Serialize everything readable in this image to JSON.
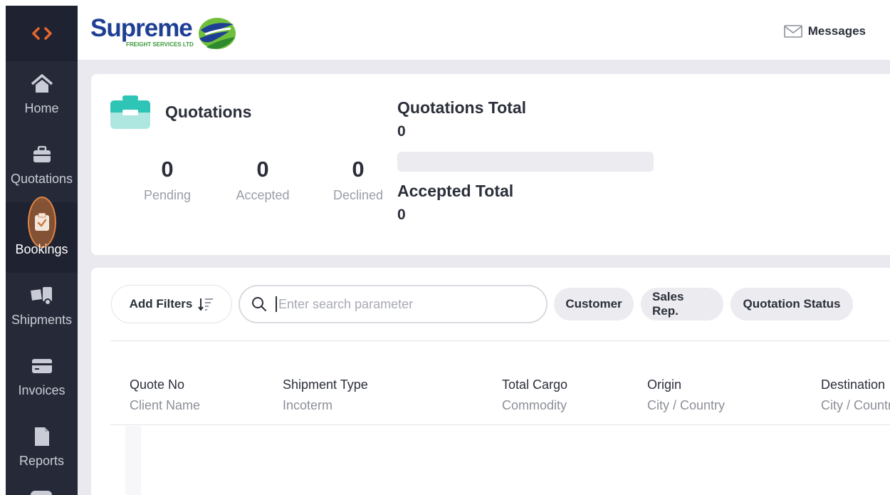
{
  "sidebar": {
    "logo_glyph": "<>",
    "items": [
      {
        "label": "Home",
        "icon": "home-icon"
      },
      {
        "label": "Quotations",
        "icon": "briefcase-icon"
      },
      {
        "label": "Bookings",
        "icon": "clipboard-check-icon",
        "active": true
      },
      {
        "label": "Shipments",
        "icon": "truck-icon"
      },
      {
        "label": "Invoices",
        "icon": "credit-card-icon"
      },
      {
        "label": "Reports",
        "icon": "document-icon"
      }
    ]
  },
  "header": {
    "brand_name": "Supreme",
    "brand_sub": "FREIGHT SERVICES LTD",
    "messages_label": "Messages"
  },
  "stats": {
    "title": "Quotations",
    "pending": {
      "value": "0",
      "label": "Pending"
    },
    "accepted": {
      "value": "0",
      "label": "Accepted"
    },
    "declined": {
      "value": "0",
      "label": "Declined"
    },
    "quotations_total_label": "Quotations Total",
    "quotations_total_value": "0",
    "accepted_total_label": "Accepted Total",
    "accepted_total_value": "0",
    "accepted_progress_fraction": 0
  },
  "filters": {
    "add_filters_label": "Add Filters",
    "search_placeholder": "Enter search parameter",
    "search_value": "",
    "chips": [
      "Customer",
      "Sales Rep.",
      "Quotation Status"
    ]
  },
  "table": {
    "columns": [
      {
        "primary": "Quote No",
        "secondary": "Client Name"
      },
      {
        "primary": "Shipment Type",
        "secondary": "Incoterm"
      },
      {
        "primary": "Total Cargo",
        "secondary": "Commodity"
      },
      {
        "primary": "Origin",
        "secondary": "City / Country"
      },
      {
        "primary": "Destination",
        "secondary": "City / Country"
      }
    ]
  },
  "colors": {
    "sidebar_bg": "#262a38",
    "accent_orange": "#e8662c",
    "brand_blue": "#1e3f93",
    "brand_green": "#3a9a3a",
    "teal_icon": "#2ec4b6"
  }
}
